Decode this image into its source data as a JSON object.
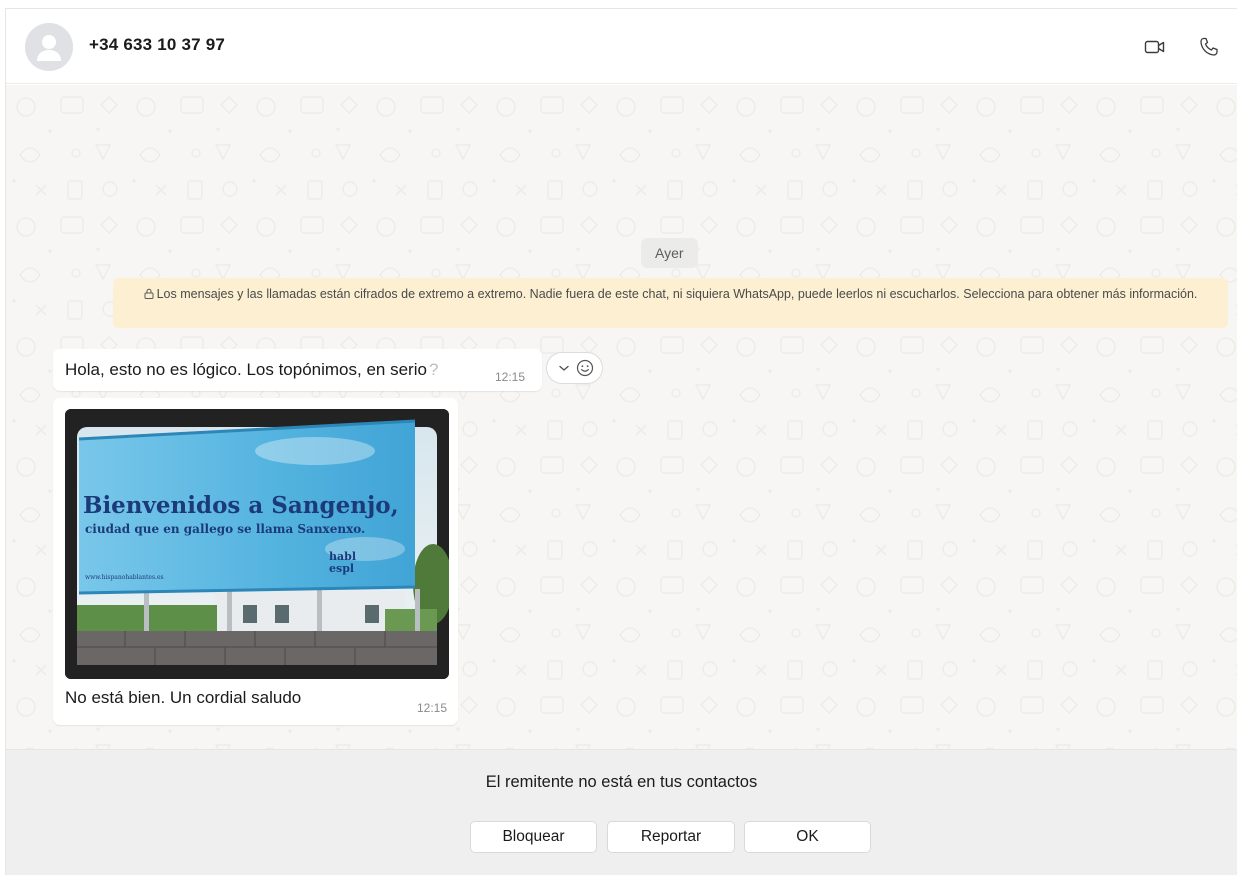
{
  "header": {
    "contact": "+34 633 10 37 97",
    "icons": {
      "avatar": "default-avatar-icon",
      "video": "video-camera-icon",
      "call": "phone-icon"
    }
  },
  "chat": {
    "date_separator": "Ayer",
    "encryption_notice": "Los mensajes y las llamadas están cifrados de extremo a extremo. Nadie fuera de este chat, ni siquiera WhatsApp, puede leerlos ni escucharlos. Selecciona para obtener más información.",
    "messages": [
      {
        "text": "Hola, esto no es lógico. Los topónimos, en serio",
        "glyph": "?",
        "time": "12:15"
      },
      {
        "image": {
          "headline": "Bienvenidos a Sangenjo,",
          "subline": "ciudad que en gallego se llama Sanxenxo.",
          "url": "www.hispanohablantes.es",
          "logo_line1": "habl",
          "logo_line2": "espl"
        },
        "text": "No está bien. Un cordial saludo",
        "time": "12:15"
      }
    ]
  },
  "unknown_sender": {
    "title": "El remitente no está en tus contactos",
    "buttons": {
      "block": "Bloquear",
      "report": "Reportar",
      "ok": "OK"
    }
  },
  "colors": {
    "chat_bg": "#f7f6f4",
    "notice_bg": "#fdf0d2",
    "bubble": "#ffffff",
    "bottom_bg": "#efefef",
    "billboard_blue": "#5bbde3",
    "headline_blue": "#1c3a7a"
  }
}
